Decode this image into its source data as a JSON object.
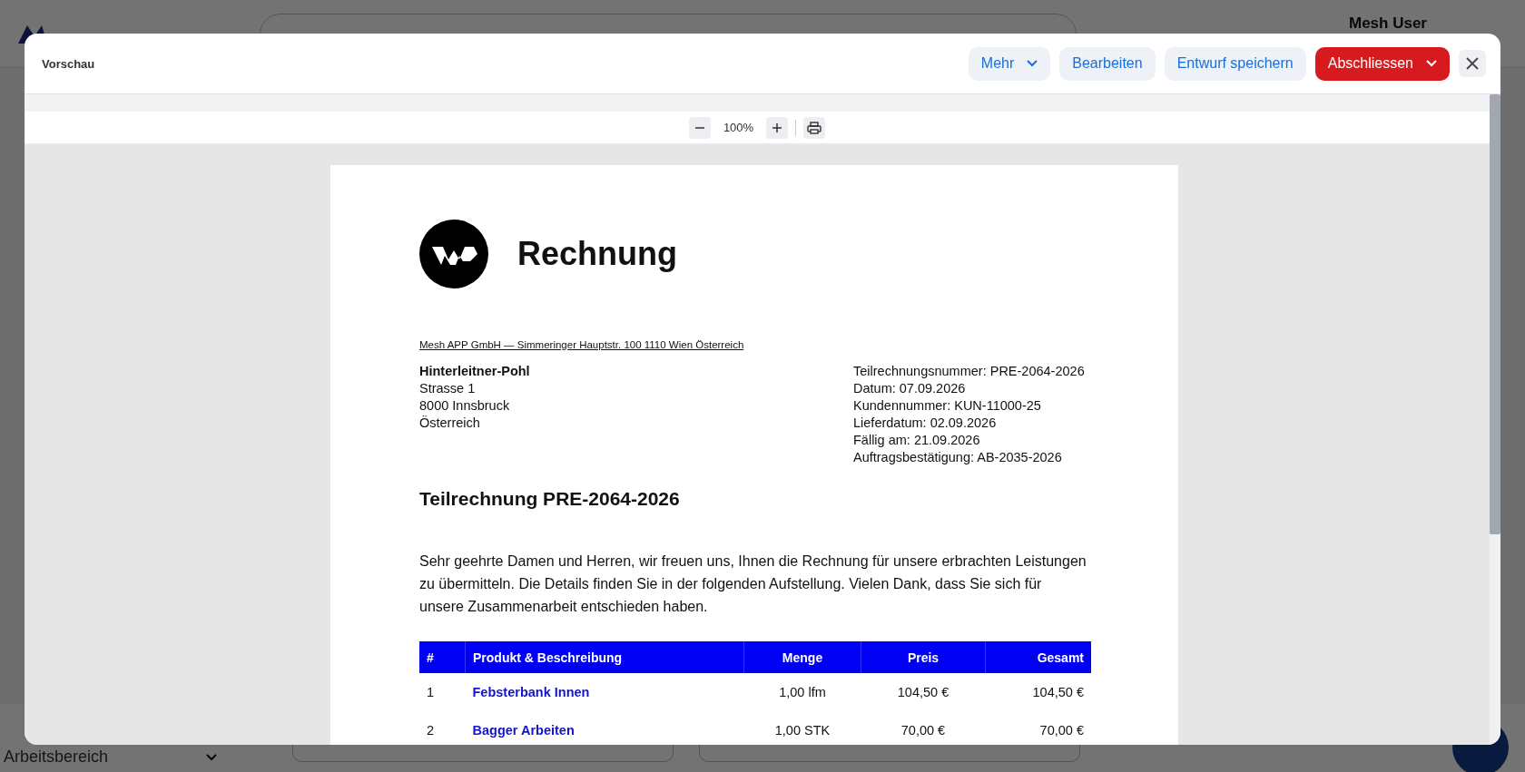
{
  "background": {
    "user_name": "Mesh User",
    "workspace": {
      "subtitle": "Arbeitsbereich"
    }
  },
  "dialog": {
    "title": "Vorschau",
    "buttons": [
      {
        "label": "Mehr",
        "kind": "secondary",
        "has_menu": true
      },
      {
        "label": "Bearbeiten",
        "kind": "secondary",
        "has_menu": false
      },
      {
        "label": "Entwurf speichern",
        "kind": "secondary",
        "has_menu": false
      },
      {
        "label": "Abschliessen",
        "kind": "primary",
        "has_menu": true
      }
    ]
  },
  "viewer": {
    "zoom": "100%"
  },
  "document": {
    "title": "Rechnung",
    "sender_line": "Mesh APP GmbH — Simmeringer Hauptstr. 100 1110 Wien Österreich",
    "recipient": {
      "name": "Hinterleitner-Pohl",
      "lines": [
        "Strasse 1",
        "8000 Innsbruck",
        "Österreich"
      ]
    },
    "meta": [
      "Teilrechnungsnummer: PRE-2064-2026",
      "Datum: 07.09.2026",
      "Kundennummer: KUN-11000-25",
      "Lieferdatum: 02.09.2026",
      "Fällig am: 21.09.2026",
      "Auftragsbestätigung: AB-2035-2026"
    ],
    "heading": "Teilrechnung PRE-2064-2026",
    "intro": "Sehr geehrte Damen und Herren, wir freuen uns, Ihnen die Rechnung für unsere erbrachten Leistungen zu übermitteln. Die Details finden Sie in der folgenden Aufstellung. Vielen Dank, dass Sie sich für unsere Zusammenarbeit entschieden haben.",
    "table": {
      "columns": [
        "#",
        "Produkt & Beschreibung",
        "Menge",
        "Preis",
        "Gesamt"
      ],
      "rows": [
        [
          "1",
          "Febsterbank Innen",
          "1,00 lfm",
          "104,50 €",
          "104,50 €"
        ],
        [
          "2",
          "Bagger Arbeiten",
          "1,00 STK",
          "70,00 €",
          "70,00 €"
        ]
      ]
    }
  }
}
